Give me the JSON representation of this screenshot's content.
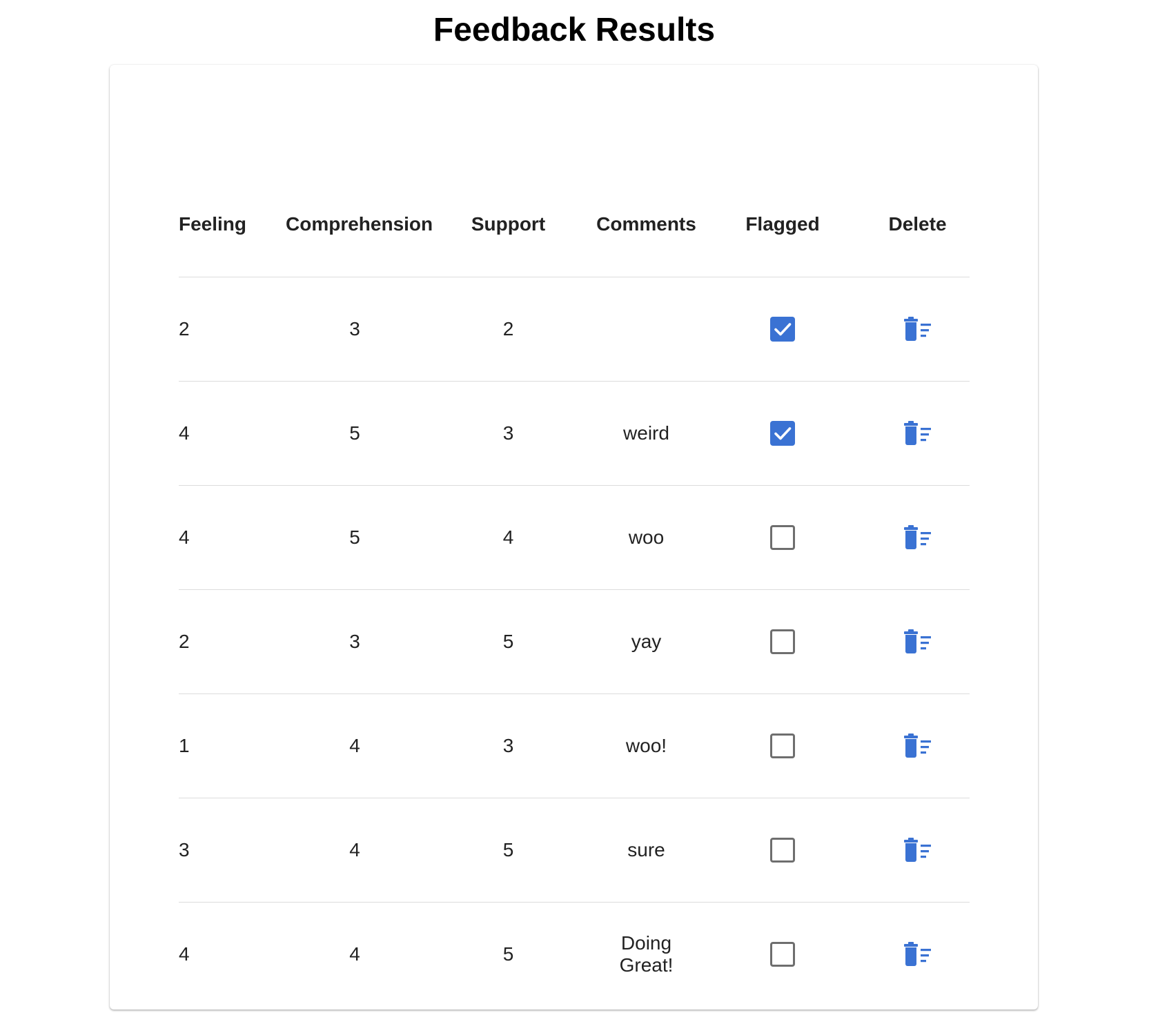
{
  "page": {
    "title": "Feedback Results"
  },
  "colors": {
    "accent": "#3a72d3",
    "checkbox_border": "#6e6e6e",
    "divider": "#dcdcdc"
  },
  "table": {
    "headers": {
      "feeling": "Feeling",
      "comprehension": "Comprehension",
      "support": "Support",
      "comments": "Comments",
      "flagged": "Flagged",
      "delete": "Delete"
    },
    "rows": [
      {
        "feeling": "2",
        "comprehension": "3",
        "support": "2",
        "comments": "",
        "flagged": true,
        "delete_icon": "delete-sweep-icon"
      },
      {
        "feeling": "4",
        "comprehension": "5",
        "support": "3",
        "comments": "weird",
        "flagged": true,
        "delete_icon": "delete-sweep-icon"
      },
      {
        "feeling": "4",
        "comprehension": "5",
        "support": "4",
        "comments": "woo",
        "flagged": false,
        "delete_icon": "delete-sweep-icon"
      },
      {
        "feeling": "2",
        "comprehension": "3",
        "support": "5",
        "comments": "yay",
        "flagged": false,
        "delete_icon": "delete-sweep-icon"
      },
      {
        "feeling": "1",
        "comprehension": "4",
        "support": "3",
        "comments": "woo!",
        "flagged": false,
        "delete_icon": "delete-sweep-icon"
      },
      {
        "feeling": "3",
        "comprehension": "4",
        "support": "5",
        "comments": "sure",
        "flagged": false,
        "delete_icon": "delete-sweep-icon"
      },
      {
        "feeling": "4",
        "comprehension": "4",
        "support": "5",
        "comments": "Doing Great!",
        "flagged": false,
        "delete_icon": "delete-sweep-icon"
      }
    ]
  }
}
